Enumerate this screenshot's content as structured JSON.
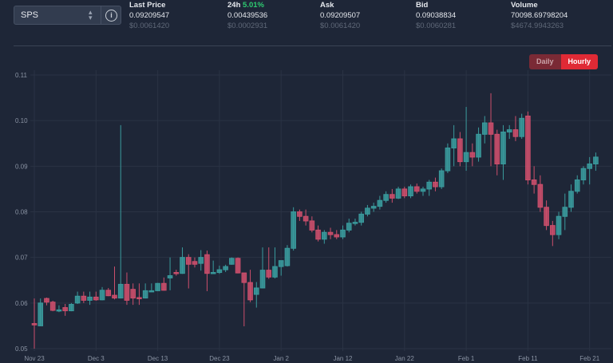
{
  "selector": {
    "value": "SPS",
    "chevron_icon": "chevron-up-down-icon",
    "info_icon": "info-icon"
  },
  "stats": [
    {
      "label": "Last Price",
      "value": "0.09209547",
      "usd": "$0.0061420"
    },
    {
      "label": "24h",
      "change_pct": "5.01%",
      "value": "0.00439536",
      "usd": "$0.0002931"
    },
    {
      "label": "Ask",
      "value": "0.09209507",
      "usd": "$0.0061420"
    },
    {
      "label": "Bid",
      "value": "0.09038834",
      "usd": "$0.0060281"
    },
    {
      "label": "Volume",
      "value": "70098.69798204",
      "usd": "$4674.9943263"
    }
  ],
  "toggle": {
    "daily": "Daily",
    "hourly": "Hourly",
    "active": "Hourly"
  },
  "colors": {
    "up": "#3a9b9d",
    "down": "#cc4f6c",
    "background": "#1e2637",
    "accent": "#e02a35"
  },
  "chart_data": {
    "type": "candlestick",
    "ylim": [
      0.05,
      0.11
    ],
    "yticks": [
      "0.05",
      "0.06",
      "0.07",
      "0.08",
      "0.09",
      "0.10",
      "0.11"
    ],
    "xticks": [
      {
        "label": "Nov 23",
        "day": 0
      },
      {
        "label": "Dec 3",
        "day": 10
      },
      {
        "label": "Dec 13",
        "day": 20
      },
      {
        "label": "Dec 23",
        "day": 30
      },
      {
        "label": "Jan 2",
        "day": 40
      },
      {
        "label": "Jan 12",
        "day": 50
      },
      {
        "label": "Jan 22",
        "day": 60
      },
      {
        "label": "Feb 1",
        "day": 70
      },
      {
        "label": "Feb 11",
        "day": 80
      },
      {
        "label": "Feb 21",
        "day": 90
      }
    ],
    "ohlc": [
      [
        0.0555,
        0.061,
        0.05,
        0.0552
      ],
      [
        0.055,
        0.061,
        0.055,
        0.06
      ],
      [
        0.061,
        0.0612,
        0.0595,
        0.0602
      ],
      [
        0.0602,
        0.0605,
        0.0582,
        0.0584
      ],
      [
        0.0583,
        0.0595,
        0.058,
        0.0585
      ],
      [
        0.059,
        0.0598,
        0.0572,
        0.0583
      ],
      [
        0.0583,
        0.06,
        0.0582,
        0.0597
      ],
      [
        0.06,
        0.0625,
        0.0598,
        0.0615
      ],
      [
        0.0615,
        0.0625,
        0.06,
        0.0606
      ],
      [
        0.0606,
        0.0625,
        0.0596,
        0.0613
      ],
      [
        0.0613,
        0.0625,
        0.0605,
        0.0607
      ],
      [
        0.0607,
        0.0635,
        0.0606,
        0.0628
      ],
      [
        0.0628,
        0.0633,
        0.0615,
        0.0616
      ],
      [
        0.0617,
        0.068,
        0.0608,
        0.0611
      ],
      [
        0.0611,
        0.099,
        0.061,
        0.0641
      ],
      [
        0.0641,
        0.0667,
        0.0596,
        0.0606
      ],
      [
        0.063,
        0.0643,
        0.0596,
        0.0611
      ],
      [
        0.0612,
        0.0643,
        0.0596,
        0.061
      ],
      [
        0.0611,
        0.0643,
        0.061,
        0.0627
      ],
      [
        0.0625,
        0.0643,
        0.0624,
        0.0627
      ],
      [
        0.0627,
        0.0644,
        0.0626,
        0.0643
      ],
      [
        0.0643,
        0.0656,
        0.0627,
        0.0628
      ],
      [
        0.0655,
        0.07,
        0.0628,
        0.066
      ],
      [
        0.0667,
        0.0673,
        0.066,
        0.0666
      ],
      [
        0.0665,
        0.0722,
        0.0664,
        0.07
      ],
      [
        0.07,
        0.0707,
        0.0632,
        0.0685
      ],
      [
        0.0691,
        0.07,
        0.0678,
        0.0685
      ],
      [
        0.0687,
        0.0716,
        0.0671,
        0.07
      ],
      [
        0.0706,
        0.0715,
        0.0626,
        0.0665
      ],
      [
        0.0665,
        0.0693,
        0.0664,
        0.0667
      ],
      [
        0.0667,
        0.0682,
        0.0664,
        0.0673
      ],
      [
        0.0673,
        0.0684,
        0.0668,
        0.068
      ],
      [
        0.0685,
        0.07,
        0.0684,
        0.0698
      ],
      [
        0.0698,
        0.07,
        0.0665,
        0.0666
      ],
      [
        0.0666,
        0.0666,
        0.0549,
        0.0645
      ],
      [
        0.0645,
        0.0673,
        0.0602,
        0.0607
      ],
      [
        0.0619,
        0.0646,
        0.059,
        0.0633
      ],
      [
        0.0633,
        0.0722,
        0.0632,
        0.0672
      ],
      [
        0.0672,
        0.0722,
        0.0653,
        0.0657
      ],
      [
        0.0657,
        0.0722,
        0.0654,
        0.068
      ],
      [
        0.068,
        0.0693,
        0.066,
        0.0693
      ],
      [
        0.0682,
        0.0727,
        0.068,
        0.072
      ],
      [
        0.072,
        0.081,
        0.0715,
        0.08
      ],
      [
        0.08,
        0.0805,
        0.078,
        0.079
      ],
      [
        0.079,
        0.0805,
        0.077,
        0.078
      ],
      [
        0.078,
        0.079,
        0.0755,
        0.076
      ],
      [
        0.076,
        0.077,
        0.0735,
        0.074
      ],
      [
        0.074,
        0.076,
        0.073,
        0.0755
      ],
      [
        0.0755,
        0.0765,
        0.074,
        0.075
      ],
      [
        0.075,
        0.076,
        0.074,
        0.0745
      ],
      [
        0.0745,
        0.077,
        0.074,
        0.076
      ],
      [
        0.076,
        0.0785,
        0.0755,
        0.0775
      ],
      [
        0.0775,
        0.0785,
        0.077,
        0.0777
      ],
      [
        0.0777,
        0.08,
        0.077,
        0.0795
      ],
      [
        0.0795,
        0.0815,
        0.079,
        0.0808
      ],
      [
        0.0808,
        0.082,
        0.08,
        0.0812
      ],
      [
        0.0812,
        0.0835,
        0.0805,
        0.0825
      ],
      [
        0.0825,
        0.0845,
        0.082,
        0.0838
      ],
      [
        0.0838,
        0.085,
        0.082,
        0.083
      ],
      [
        0.083,
        0.0855,
        0.0828,
        0.085
      ],
      [
        0.085,
        0.0855,
        0.083,
        0.0835
      ],
      [
        0.0835,
        0.086,
        0.083,
        0.0855
      ],
      [
        0.0855,
        0.0862,
        0.084,
        0.0845
      ],
      [
        0.0845,
        0.0855,
        0.0835,
        0.085
      ],
      [
        0.085,
        0.087,
        0.0835,
        0.0865
      ],
      [
        0.0865,
        0.0875,
        0.0845,
        0.0855
      ],
      [
        0.0855,
        0.0895,
        0.085,
        0.089
      ],
      [
        0.089,
        0.095,
        0.0885,
        0.094
      ],
      [
        0.094,
        0.099,
        0.09,
        0.096
      ],
      [
        0.096,
        0.0975,
        0.09,
        0.091
      ],
      [
        0.091,
        0.103,
        0.089,
        0.093
      ],
      [
        0.093,
        0.095,
        0.09,
        0.092
      ],
      [
        0.092,
        0.0985,
        0.091,
        0.097
      ],
      [
        0.097,
        0.101,
        0.095,
        0.0995
      ],
      [
        0.0995,
        0.106,
        0.09,
        0.097
      ],
      [
        0.097,
        0.098,
        0.088,
        0.0905
      ],
      [
        0.0905,
        0.099,
        0.087,
        0.0975
      ],
      [
        0.0975,
        0.099,
        0.096,
        0.098
      ],
      [
        0.098,
        0.101,
        0.0955,
        0.0965
      ],
      [
        0.0965,
        0.1015,
        0.096,
        0.1005
      ],
      [
        0.101,
        0.102,
        0.086,
        0.087
      ],
      [
        0.087,
        0.09,
        0.084,
        0.086
      ],
      [
        0.086,
        0.088,
        0.08,
        0.081
      ],
      [
        0.081,
        0.0825,
        0.076,
        0.077
      ],
      [
        0.077,
        0.078,
        0.0725,
        0.075
      ],
      [
        0.075,
        0.08,
        0.074,
        0.079
      ],
      [
        0.079,
        0.084,
        0.076,
        0.081
      ],
      [
        0.081,
        0.086,
        0.08,
        0.0845
      ],
      [
        0.0845,
        0.088,
        0.084,
        0.087
      ],
      [
        0.087,
        0.09,
        0.086,
        0.0895
      ],
      [
        0.0895,
        0.092,
        0.086,
        0.0905
      ],
      [
        0.0905,
        0.093,
        0.089,
        0.092
      ]
    ]
  }
}
